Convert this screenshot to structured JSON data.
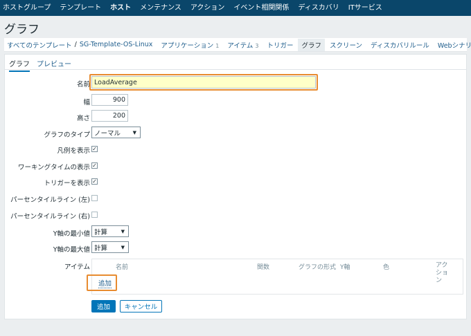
{
  "topnav": {
    "items": [
      {
        "label": "ホストグループ",
        "active": false
      },
      {
        "label": "テンプレート",
        "active": false
      },
      {
        "label": "ホスト",
        "active": true
      },
      {
        "label": "メンテナンス",
        "active": false
      },
      {
        "label": "アクション",
        "active": false
      },
      {
        "label": "イベント相関関係",
        "active": false
      },
      {
        "label": "ディスカバリ",
        "active": false
      },
      {
        "label": "ITサービス",
        "active": false
      }
    ]
  },
  "page": {
    "title": "グラフ"
  },
  "breadcrumb": {
    "all_templates": "すべてのテンプレート",
    "separator": "/",
    "template": "SG-Template-OS-Linux",
    "applications": "アプリケーション",
    "applications_count": "1",
    "items": "アイテム",
    "items_count": "3",
    "triggers": "トリガー",
    "graphs": "グラフ",
    "screens": "スクリーン",
    "discovery": "ディスカバリルール",
    "web": "Webシナリオ"
  },
  "tabs": {
    "graph": "グラフ",
    "preview": "プレビュー"
  },
  "form": {
    "name_label": "名前",
    "name_value": "LoadAverage",
    "width_label": "幅",
    "width_value": "900",
    "height_label": "高さ",
    "height_value": "200",
    "graph_type_label": "グラフのタイプ",
    "graph_type_value": "ノーマル",
    "show_legend_label": "凡例を表示",
    "show_working_time_label": "ワーキングタイムの表示",
    "show_triggers_label": "トリガーを表示",
    "percentile_left_label": "パーセンタイルライン (左)",
    "percentile_right_label": "パーセンタイルライン (右)",
    "ymin_label": "Y軸の最小値",
    "ymin_value": "計算",
    "ymax_label": "Y軸の最大値",
    "ymax_value": "計算",
    "items_label": "アイテム"
  },
  "items_table": {
    "headers": {
      "name": "名前",
      "function": "関数",
      "draw_style": "グラフの形式",
      "y_axis": "Y軸",
      "color": "色",
      "action": "アクション"
    },
    "add_link": "追加"
  },
  "buttons": {
    "add": "追加",
    "cancel": "キャンセル"
  },
  "colors": {
    "nav_bg": "#0a466a",
    "primary": "#0275b8",
    "highlight": "#e88b2f",
    "input_highlight": "#ffffc8"
  }
}
